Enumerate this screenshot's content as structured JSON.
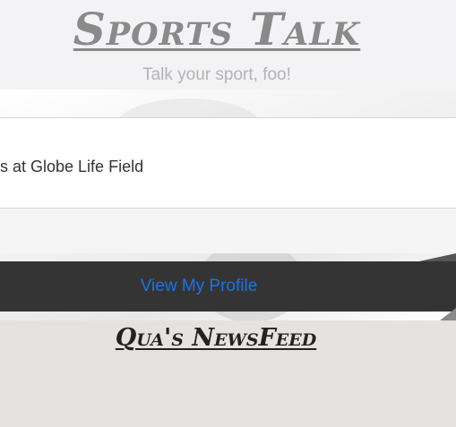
{
  "header": {
    "title": "Sports Talk",
    "tagline": "Talk your sport, foo!"
  },
  "card": {
    "text": "s at Globe Life Field"
  },
  "profile": {
    "link_label": "View My Profile"
  },
  "newsfeed": {
    "title": "Qua's NewsFeed"
  },
  "colors": {
    "header_bg": "#f3f3f5",
    "title_gray": "#8a8a8a",
    "link_blue": "#1a73e8",
    "profile_bar_bg": "#343434",
    "feed_bg": "#e6e2e0"
  }
}
